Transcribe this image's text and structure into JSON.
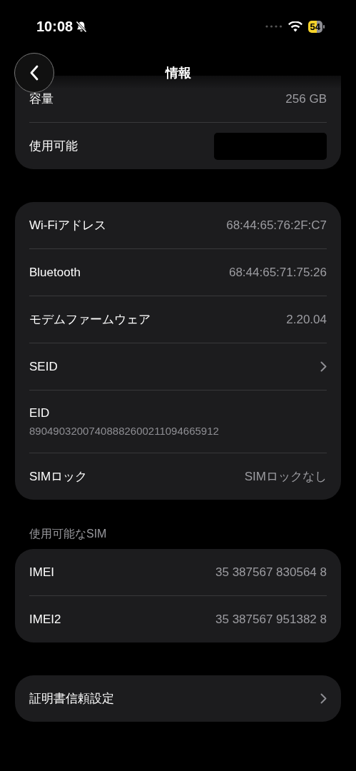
{
  "status_bar": {
    "time": "10:08",
    "silent": true,
    "battery": "54"
  },
  "header": {
    "title": "情報"
  },
  "cards": [
    {
      "cut_top": true,
      "rows": [
        {
          "kind": "value",
          "label": "容量",
          "value": "256 GB"
        },
        {
          "kind": "redacted",
          "label": "使用可能"
        }
      ]
    },
    {
      "cut_top": false,
      "rows": [
        {
          "kind": "value",
          "label": "Wi-Fiアドレス",
          "value": "68:44:65:76:2F:C7"
        },
        {
          "kind": "value",
          "label": "Bluetooth",
          "value": "68:44:65:71:75:26"
        },
        {
          "kind": "value",
          "label": "モデムファームウェア",
          "value": "2.20.04"
        },
        {
          "kind": "chevron",
          "label": "SEID"
        },
        {
          "kind": "stacked",
          "label": "EID",
          "value": "89049032007408882600211094665912"
        },
        {
          "kind": "value",
          "label": "SIMロック",
          "value": "SIMロックなし"
        }
      ]
    },
    {
      "section_title": "使用可能なSIM",
      "cut_top": false,
      "rows": [
        {
          "kind": "value",
          "label": "IMEI",
          "value": "35 387567 830564 8"
        },
        {
          "kind": "value",
          "label": "IMEI2",
          "value": "35 387567 951382 8"
        }
      ]
    },
    {
      "cut_top": false,
      "rows": [
        {
          "kind": "chevron",
          "label": "証明書信頼設定"
        }
      ]
    }
  ]
}
